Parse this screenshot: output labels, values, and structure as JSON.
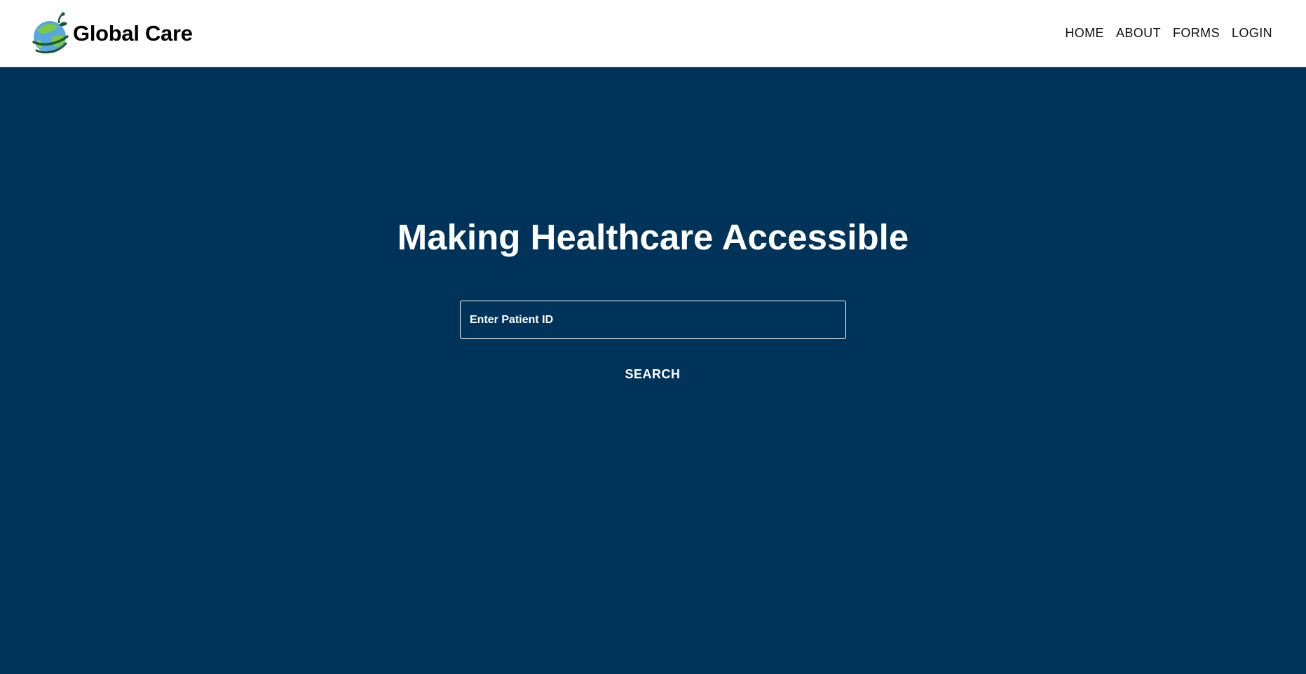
{
  "brand": {
    "name": "Global Care",
    "logo_icon": "globe-leaf-icon"
  },
  "nav": {
    "items": [
      {
        "label": "HOME"
      },
      {
        "label": "ABOUT"
      },
      {
        "label": "FORMS"
      },
      {
        "label": "LOGIN"
      }
    ]
  },
  "hero": {
    "title": "Making Healthcare Accessible",
    "search": {
      "value": "",
      "placeholder": "Enter Patient ID"
    },
    "search_button_label": "SEARCH"
  },
  "colors": {
    "header_bg": "#ffffff",
    "hero_bg": "#003359",
    "hero_text": "#ffffff",
    "nav_text": "#111111",
    "logo_green": "#4caf50",
    "logo_blue": "#5aa6e0",
    "logo_dark_green": "#1f5a2e"
  }
}
